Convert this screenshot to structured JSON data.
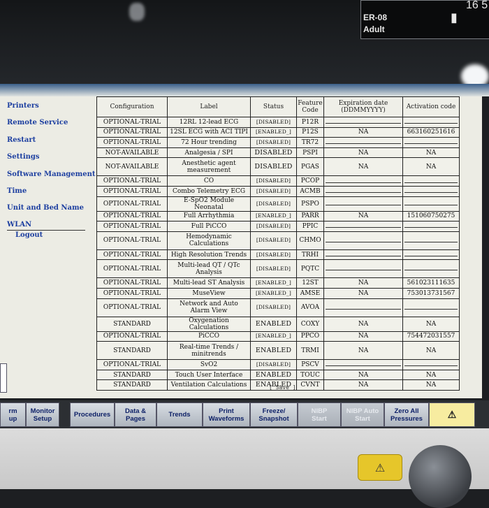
{
  "status_bar": {
    "bed_line1": "ER-08",
    "bed_line2": "Adult",
    "time": "16 5",
    "battery_icon": "battery-icon"
  },
  "menu": {
    "items": [
      "Printers",
      "Remote Service",
      "Restart",
      "Settings",
      "Software Management",
      "Time",
      "Unit and Bed Name"
    ],
    "wlan": "WLAN",
    "logout": "Logout"
  },
  "table": {
    "headers": [
      "Configuration",
      "Label",
      "Status",
      "Feature Code",
      "Expiration date (DDMMYYYY)",
      "Activation code"
    ],
    "rows": [
      {
        "config": "OPTIONAL-TRIAL",
        "label": "12RL 12-lead ECG",
        "status": "[DISABLED]",
        "code": "P12R",
        "exp": "",
        "act": ""
      },
      {
        "config": "OPTIONAL-TRIAL",
        "label": "12SL ECG with ACI TIPI",
        "status": "[ENABLED_]",
        "code": "P12S",
        "exp": "NA",
        "act": "663160251616"
      },
      {
        "config": "OPTIONAL-TRIAL",
        "label": "72 Hour trending",
        "status": "[DISABLED]",
        "code": "TR72",
        "exp": "",
        "act": ""
      },
      {
        "config": "NOT-AVAILABLE",
        "label": "Analgesia / SPI",
        "status": "DISABLED",
        "code": "PSPI",
        "exp": "NA",
        "act": "NA"
      },
      {
        "config": "NOT-AVAILABLE",
        "label": "Anesthetic agent measurement",
        "status": "DISABLED",
        "code": "PGAS",
        "exp": "NA",
        "act": "NA"
      },
      {
        "config": "OPTIONAL-TRIAL",
        "label": "CO",
        "status": "[DISABLED]",
        "code": "PCOP",
        "exp": "",
        "act": ""
      },
      {
        "config": "OPTIONAL-TRIAL",
        "label": "Combo Telemetry ECG",
        "status": "[DISABLED]",
        "code": "ACMB",
        "exp": "",
        "act": ""
      },
      {
        "config": "OPTIONAL-TRIAL",
        "label": "E-SpO2 Module Neonatal",
        "status": "[DISABLED]",
        "code": "PSPO",
        "exp": "",
        "act": ""
      },
      {
        "config": "OPTIONAL-TRIAL",
        "label": "Full Arrhythmia",
        "status": "[ENABLED_]",
        "code": "PARR",
        "exp": "NA",
        "act": "151060750275"
      },
      {
        "config": "OPTIONAL-TRIAL",
        "label": "Full PiCCO",
        "status": "[DISABLED]",
        "code": "PPIC",
        "exp": "",
        "act": ""
      },
      {
        "config": "OPTIONAL-TRIAL",
        "label": "Hemodynamic Calculations",
        "status": "[DISABLED]",
        "code": "CHMO",
        "exp": "",
        "act": ""
      },
      {
        "config": "OPTIONAL-TRIAL",
        "label": "High Resolution Trends",
        "status": "[DISABLED]",
        "code": "TRHI",
        "exp": "",
        "act": ""
      },
      {
        "config": "OPTIONAL-TRIAL",
        "label": "Multi-lead QT / QTc Analysis",
        "status": "[DISABLED]",
        "code": "PQTC",
        "exp": "",
        "act": ""
      },
      {
        "config": "OPTIONAL-TRIAL",
        "label": "Multi-lead ST Analysis",
        "status": "[ENABLED_]",
        "code": "12ST",
        "exp": "NA",
        "act": "561023111635"
      },
      {
        "config": "OPTIONAL-TRIAL",
        "label": "MuseView",
        "status": "[ENABLED_]",
        "code": "AMSE",
        "exp": "NA",
        "act": "753013731567"
      },
      {
        "config": "OPTIONAL-TRIAL",
        "label": "Network and Auto Alarm View",
        "status": "[DISABLED]",
        "code": "AVOA",
        "exp": "",
        "act": ""
      },
      {
        "config": "STANDARD",
        "label": "Oxygenation Calculations",
        "status": "ENABLED",
        "code": "COXY",
        "exp": "NA",
        "act": "NA"
      },
      {
        "config": "OPTIONAL-TRIAL",
        "label": "PiCCO",
        "status": "[ENABLED_]",
        "code": "PPCO",
        "exp": "NA",
        "act": "754472031557"
      },
      {
        "config": "STANDARD",
        "label": "Real-time Trends / minitrends",
        "status": "ENABLED",
        "code": "TRMI",
        "exp": "NA",
        "act": "NA"
      },
      {
        "config": "OPTIONAL-TRIAL",
        "label": "SvO2",
        "status": "[DISABLED]",
        "code": "PSCV",
        "exp": "",
        "act": ""
      },
      {
        "config": "STANDARD",
        "label": "Touch User Interface",
        "status": "ENABLED",
        "code": "TOUC",
        "exp": "NA",
        "act": "NA"
      },
      {
        "config": "STANDARD",
        "label": "Ventilation Calculations",
        "status": "ENABLED",
        "code": "CVNT",
        "exp": "NA",
        "act": "NA"
      }
    ]
  },
  "save_label": "[ Save ]",
  "keys": [
    {
      "label": "rm\nup",
      "enabled": true
    },
    {
      "label": "Monitor\nSetup",
      "enabled": true
    },
    {
      "label": "Procedures",
      "enabled": true
    },
    {
      "label": "Data &\nPages",
      "enabled": true
    },
    {
      "label": "Trends",
      "enabled": true
    },
    {
      "label": "Print\nWaveforms",
      "enabled": true
    },
    {
      "label": "Freeze/\nSnapshot",
      "enabled": true
    },
    {
      "label": "NIBP\nStart",
      "enabled": false
    },
    {
      "label": "NIBP Auto\nStart",
      "enabled": false
    },
    {
      "label": "Zero All\nPressures",
      "enabled": true
    },
    {
      "label": "alarm-silence-icon",
      "enabled": true
    }
  ],
  "colors": {
    "menu_text": "#1d3fa0",
    "key_text": "#0c1f66",
    "alarm_key": "#f7eca0",
    "hard_button": "#e6c62a"
  }
}
